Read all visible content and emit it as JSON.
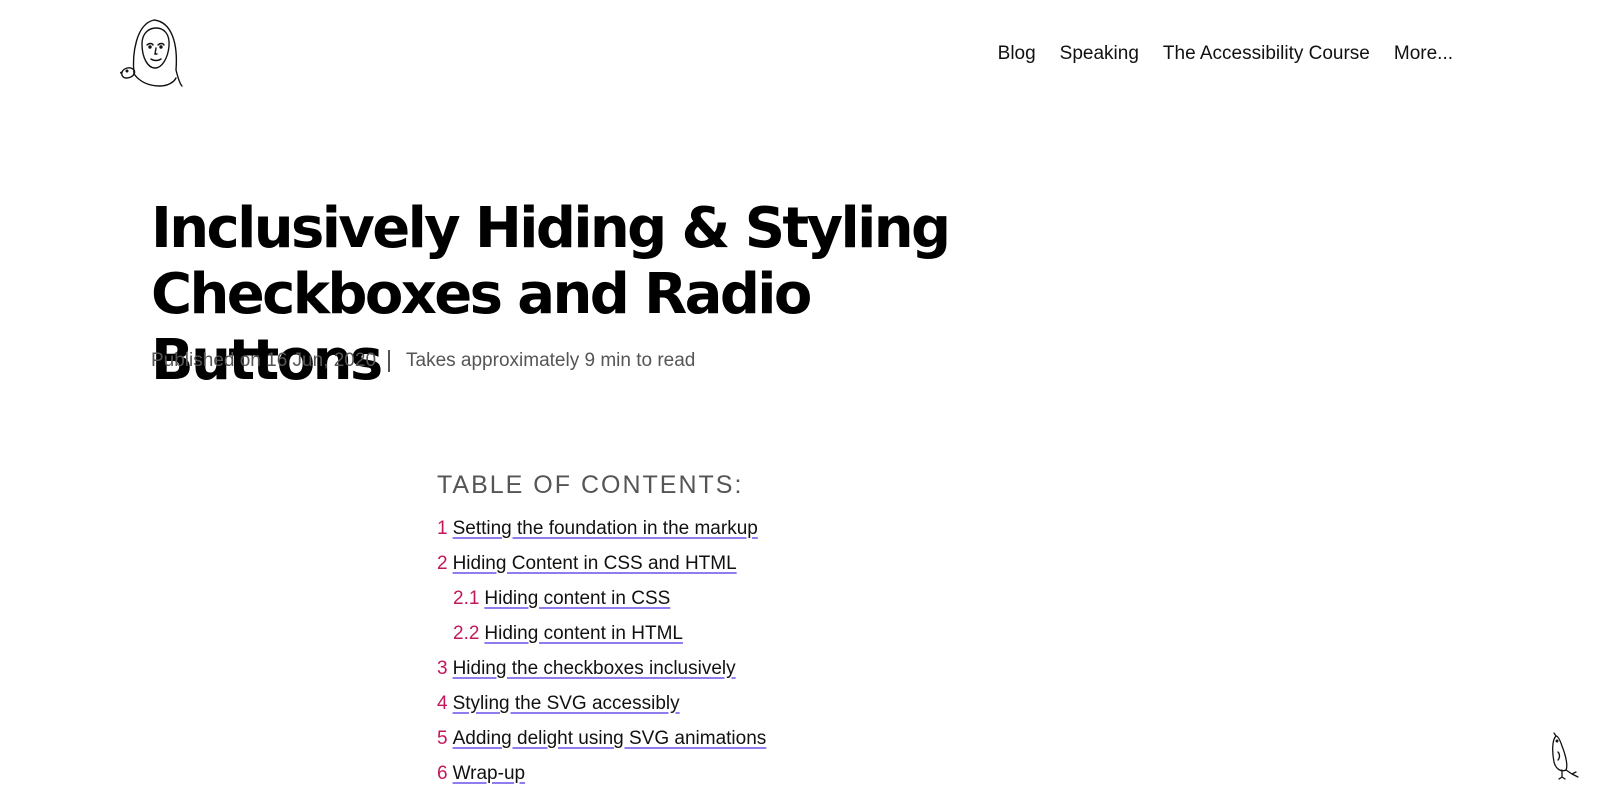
{
  "logo": {
    "icon": "author-illustration-icon",
    "alt": "site logo"
  },
  "nav": {
    "items": [
      {
        "label": "Blog"
      },
      {
        "label": "Speaking"
      },
      {
        "label": "The Accessibility Course"
      },
      {
        "label": "More..."
      }
    ]
  },
  "article": {
    "title": "Inclusively Hiding & Styling Checkboxes and Radio Buttons",
    "published": "Published on 16 Jun, 2020",
    "reading_time": "Takes approximately 9 min to read"
  },
  "toc": {
    "heading": "TABLE OF CONTENTS:",
    "items": [
      {
        "number": "1",
        "label": "Setting the foundation in the markup"
      },
      {
        "number": "2",
        "label": "Hiding Content in CSS and HTML"
      },
      {
        "number": "2.1",
        "label": "Hiding content in CSS"
      },
      {
        "number": "2.2",
        "label": "Hiding content in HTML"
      },
      {
        "number": "3",
        "label": "Hiding the checkboxes inclusively"
      },
      {
        "number": "4",
        "label": "Styling the SVG accessibly"
      },
      {
        "number": "5",
        "label": "Adding delight using SVG animations"
      },
      {
        "number": "6",
        "label": "Wrap-up"
      }
    ]
  },
  "colors": {
    "accent_number": "#c2185b",
    "link_underline": "#8f7df0",
    "meta_text": "#555555"
  },
  "decor": {
    "bird_icon": "bird-doodle-icon"
  }
}
